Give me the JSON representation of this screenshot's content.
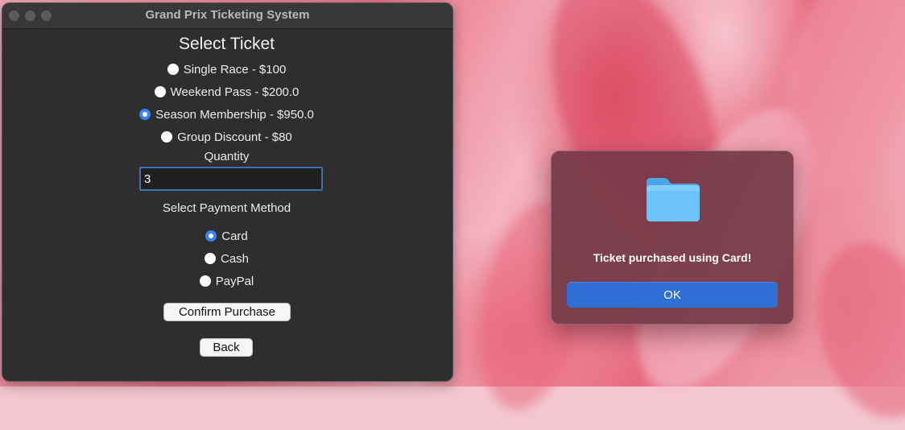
{
  "window": {
    "title": "Grand Prix Ticketing System"
  },
  "ticket_section": {
    "heading": "Select Ticket",
    "options": [
      {
        "label": "Single Race - $100",
        "checked": false
      },
      {
        "label": "Weekend Pass - $200.0",
        "checked": false
      },
      {
        "label": "Season Membership - $950.0",
        "checked": true
      },
      {
        "label": "Group Discount - $80",
        "checked": false
      }
    ]
  },
  "quantity": {
    "label": "Quantity",
    "value": "3"
  },
  "payment_section": {
    "heading": "Select Payment Method",
    "options": [
      {
        "label": "Card",
        "checked": true
      },
      {
        "label": "Cash",
        "checked": false
      },
      {
        "label": "PayPal",
        "checked": false
      }
    ]
  },
  "buttons": {
    "confirm": "Confirm Purchase",
    "back": "Back"
  },
  "dialog": {
    "icon": "folder-icon",
    "message": "Ticket purchased using Card!",
    "ok": "OK"
  },
  "colors": {
    "accent": "#3b82f6",
    "ok_button": "#2f6fd6",
    "window_bg": "#2e2e2e"
  }
}
